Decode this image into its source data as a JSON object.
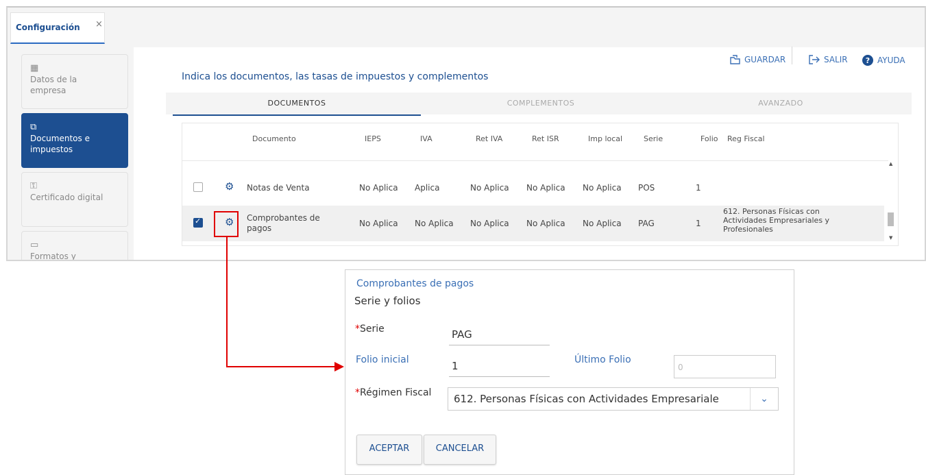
{
  "tab": {
    "label": "Configuración",
    "close": "×"
  },
  "sidebar": {
    "items": [
      {
        "label": "Datos de la empresa",
        "icon": "▦"
      },
      {
        "label": "Documentos e impuestos",
        "icon": "⧉"
      },
      {
        "label": "Certificado digital",
        "icon": "⚿"
      },
      {
        "label": "Formatos y",
        "icon": "▭"
      }
    ]
  },
  "toolbar": {
    "save": "GUARDAR",
    "exit": "SALIR",
    "help": "AYUDA"
  },
  "subtitle": "Indica los documentos, las tasas de impuestos y complementos",
  "doc_tabs": [
    "DOCUMENTOS",
    "COMPLEMENTOS",
    "AVANZADO"
  ],
  "table": {
    "headers": [
      "Documento",
      "IEPS",
      "IVA",
      "Ret IVA",
      "Ret ISR",
      "Imp local",
      "Serie",
      "Folio",
      "Reg Fiscal"
    ],
    "rows": [
      {
        "checked": false,
        "documento": "Notas de Venta",
        "ieps": "No Aplica",
        "iva": "Aplica",
        "ret_iva": "No Aplica",
        "ret_isr": "No Aplica",
        "imp_local": "No Aplica",
        "serie": "POS",
        "folio": "1",
        "reg_fiscal": ""
      },
      {
        "checked": true,
        "documento": "Comprobantes de pagos",
        "ieps": "No Aplica",
        "iva": "No Aplica",
        "ret_iva": "No Aplica",
        "ret_isr": "No Aplica",
        "imp_local": "No Aplica",
        "serie": "PAG",
        "folio": "1",
        "reg_fiscal": "612. Personas Físicas con Actividades Empresariales y Profesionales"
      }
    ]
  },
  "dialog": {
    "title": "Comprobantes de pagos",
    "subtitle": "Serie y folios",
    "serie_label": "Serie",
    "serie_value": "PAG",
    "folio_inicial_label": "Folio inicial",
    "folio_inicial_value": "1",
    "ultimo_folio_label": "Último Folio",
    "ultimo_folio_placeholder": "0",
    "regimen_label": "Régimen Fiscal",
    "regimen_value": "612. Personas Físicas con Actividades Empresariale",
    "required_mark": "*",
    "accept": "ACEPTAR",
    "cancel": "CANCELAR"
  },
  "colors": {
    "accent": "#1d4f91",
    "link": "#3a6fb5",
    "annotation": "#e00000"
  }
}
